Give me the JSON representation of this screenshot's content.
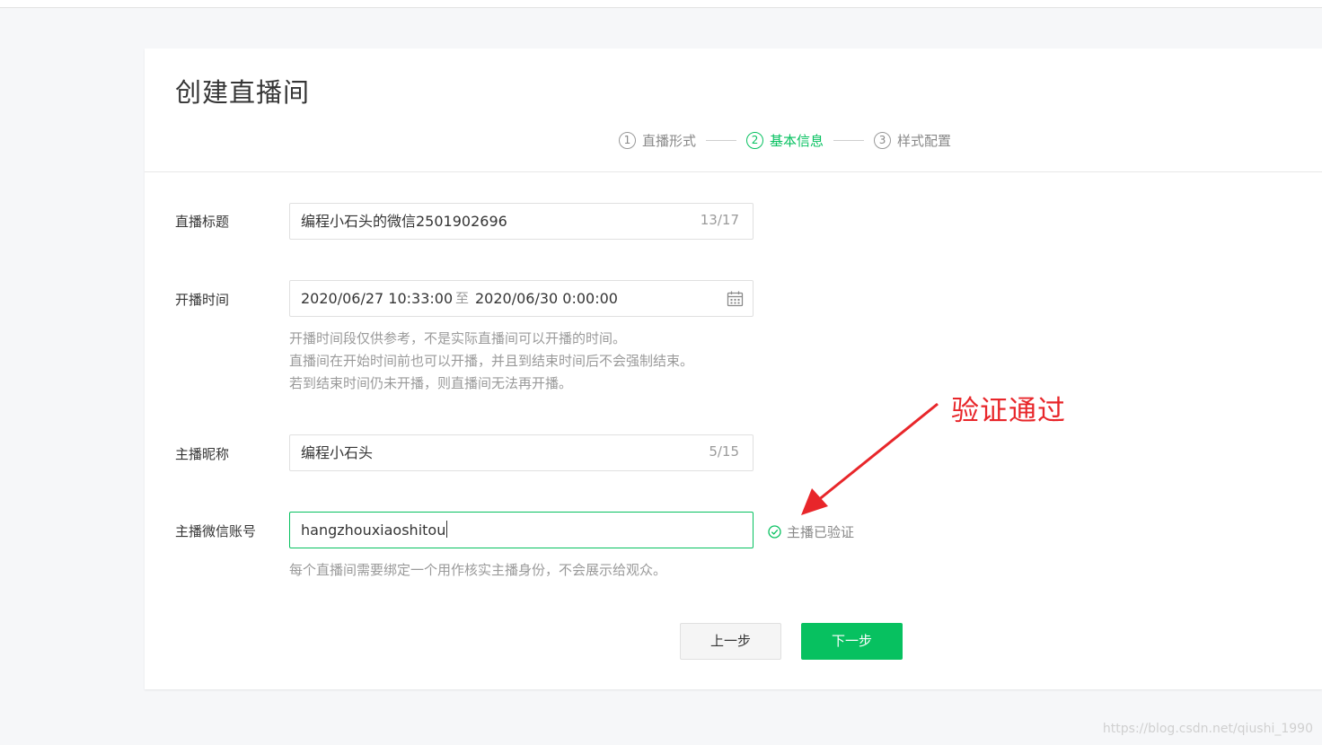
{
  "page": {
    "title": "创建直播间"
  },
  "steps": [
    {
      "num": "1",
      "label": "直播形式"
    },
    {
      "num": "2",
      "label": "基本信息"
    },
    {
      "num": "3",
      "label": "样式配置"
    }
  ],
  "form": {
    "title": {
      "label": "直播标题",
      "value": "编程小石头的微信2501902696",
      "counter": "13/17"
    },
    "time": {
      "label": "开播时间",
      "start": "2020/06/27 10:33:00",
      "separator": "至",
      "end": "2020/06/30 0:00:00",
      "hints": [
        "开播时间段仅供参考，不是实际直播间可以开播的时间。",
        "直播间在开始时间前也可以开播，并且到结束时间后不会强制结束。",
        "若到结束时间仍未开播，则直播间无法再开播。"
      ]
    },
    "nickname": {
      "label": "主播昵称",
      "value": "编程小石头",
      "counter": "5/15"
    },
    "wechat": {
      "label": "主播微信账号",
      "value": "hangzhouxiaoshitou",
      "verified_text": "主播已验证",
      "hint": "每个直播间需要绑定一个用作核实主播身份，不会展示给观众。"
    }
  },
  "buttons": {
    "prev": "上一步",
    "next": "下一步"
  },
  "annotation": {
    "text": "验证通过"
  },
  "watermark": "https://blog.csdn.net/qiushi_1990",
  "colors": {
    "accent": "#07c160",
    "annotation": "#e8262a",
    "hint": "#9a9a9a"
  }
}
